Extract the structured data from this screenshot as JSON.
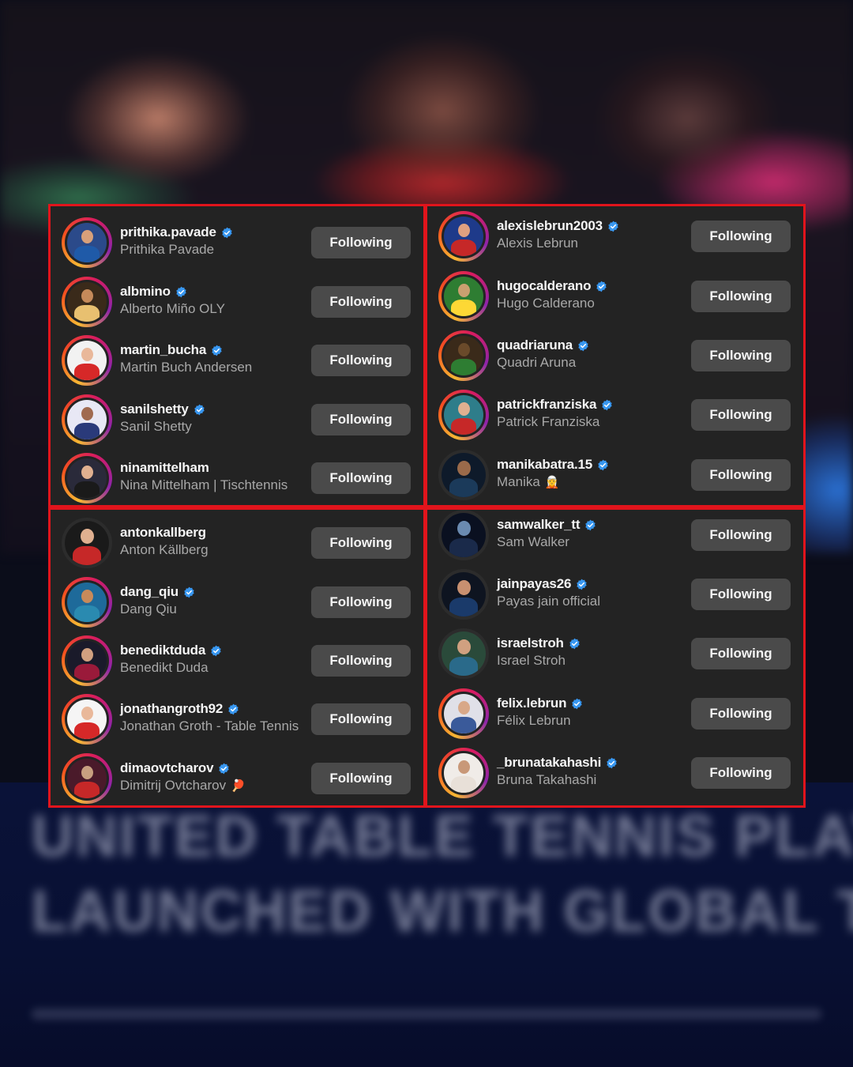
{
  "background_text": {
    "line1": "UNITED TABLE TENNIS PLAYERS (UTTP)",
    "line2": "LAUNCHED WITH GLOBAL TT-STARS"
  },
  "colors": {
    "panel_border": "#e1141c",
    "panel_bg": "#232323",
    "button_bg": "#4a4a4a",
    "verified": "#3897f0"
  },
  "panels": [
    {
      "rows": [
        {
          "username": "prithika.pavade",
          "name": "Prithika Pavade",
          "verified": true,
          "button": "Following"
        },
        {
          "username": "albmino",
          "name": "Alberto Miño OLY",
          "verified": true,
          "button": "Following"
        },
        {
          "username": "martin_bucha",
          "name": "Martin Buch Andersen",
          "verified": true,
          "button": "Following"
        },
        {
          "username": "sanilshetty",
          "name": "Sanil Shetty",
          "verified": true,
          "button": "Following"
        },
        {
          "username": "ninamittelham",
          "name": "Nina Mittelham | Tischtennis",
          "verified": false,
          "button": "Following"
        }
      ]
    },
    {
      "rows": [
        {
          "username": "alexislebrun2003",
          "name": "Alexis Lebrun",
          "verified": true,
          "button": "Following"
        },
        {
          "username": "hugocalderano",
          "name": "Hugo Calderano",
          "verified": true,
          "button": "Following"
        },
        {
          "username": "quadriaruna",
          "name": "Quadri Aruna",
          "verified": true,
          "button": "Following"
        },
        {
          "username": "patrickfranziska",
          "name": "Patrick Franziska",
          "verified": true,
          "button": "Following"
        },
        {
          "username": "manikabatra.15",
          "name": "Manika",
          "emoji": "🧝",
          "verified": true,
          "button": "Following"
        }
      ]
    },
    {
      "rows": [
        {
          "username": "antonkallberg",
          "name": "Anton Källberg",
          "verified": false,
          "button": "Following"
        },
        {
          "username": "dang_qiu",
          "name": "Dang Qiu",
          "verified": true,
          "button": "Following"
        },
        {
          "username": "benediktduda",
          "name": "Benedikt Duda",
          "verified": true,
          "button": "Following"
        },
        {
          "username": "jonathangroth92",
          "name": "Jonathan Groth - Table Tennis",
          "verified": true,
          "button": "Following"
        },
        {
          "username": "dimaovtcharov",
          "name": "Dimitrij Ovtcharov",
          "emoji": "🏓",
          "verified": true,
          "button": "Following"
        }
      ]
    },
    {
      "rows": [
        {
          "username": "samwalker_tt",
          "name": "Sam Walker",
          "verified": true,
          "button": "Following"
        },
        {
          "username": "jainpayas26",
          "name": "Payas jain official",
          "verified": true,
          "button": "Following"
        },
        {
          "username": "israelstroh",
          "name": "Israel Stroh",
          "verified": true,
          "button": "Following"
        },
        {
          "username": "felix.lebrun",
          "name": "Félix Lebrun",
          "verified": true,
          "button": "Following"
        },
        {
          "username": "_brunatakahashi",
          "name": "Bruna Takahashi",
          "verified": true,
          "button": "Following"
        }
      ]
    }
  ]
}
